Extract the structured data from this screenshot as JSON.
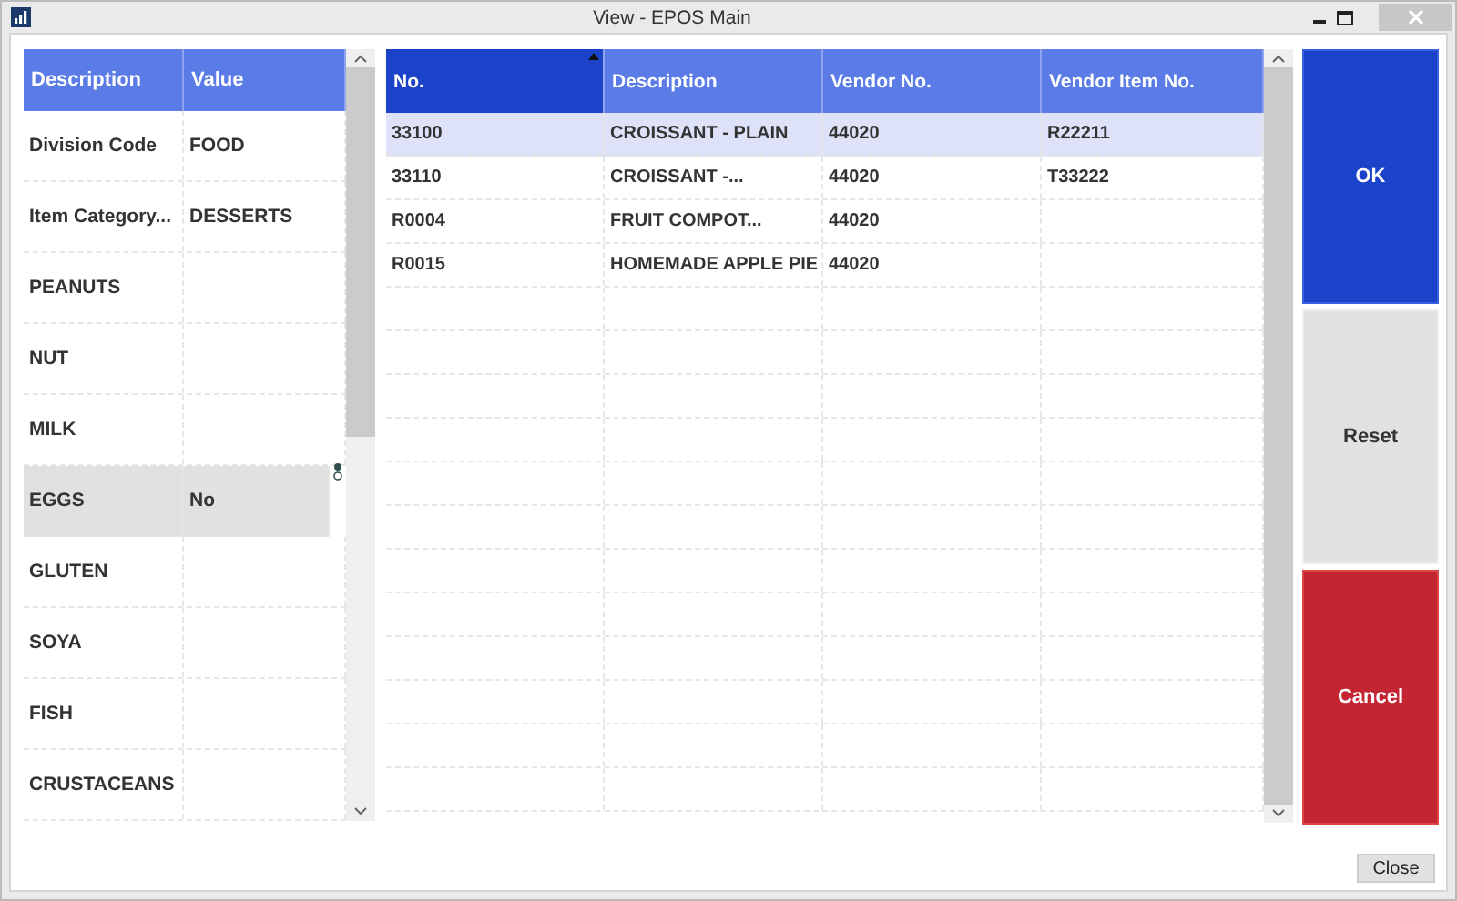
{
  "window": {
    "title": "View - EPOS Main"
  },
  "properties": {
    "columns": [
      "Description",
      "Value"
    ],
    "rows": [
      {
        "description": "Division Code",
        "value": "FOOD",
        "selected": false
      },
      {
        "description": "Item Category...",
        "value": "DESSERTS",
        "selected": false
      },
      {
        "description": "PEANUTS",
        "value": "",
        "selected": false
      },
      {
        "description": "NUT",
        "value": "",
        "selected": false
      },
      {
        "description": "MILK",
        "value": "",
        "selected": false
      },
      {
        "description": "EGGS",
        "value": "No",
        "selected": true
      },
      {
        "description": "GLUTEN",
        "value": "",
        "selected": false
      },
      {
        "description": "SOYA",
        "value": "",
        "selected": false
      },
      {
        "description": "FISH",
        "value": "",
        "selected": false
      },
      {
        "description": "CRUSTACEANS",
        "value": "",
        "selected": false
      }
    ]
  },
  "items": {
    "columns": [
      {
        "label": "No.",
        "sorted": true
      },
      {
        "label": "Description",
        "sorted": false
      },
      {
        "label": "Vendor No.",
        "sorted": false
      },
      {
        "label": "Vendor Item No.",
        "sorted": false
      }
    ],
    "rows": [
      {
        "cells": [
          "33100",
          "CROISSANT - PLAIN",
          "44020",
          "R22211"
        ],
        "selected": true
      },
      {
        "cells": [
          "33110",
          "CROISSANT -...",
          "44020",
          "T33222"
        ],
        "selected": false
      },
      {
        "cells": [
          "R0004",
          "FRUIT COMPOT...",
          "44020",
          ""
        ],
        "selected": false
      },
      {
        "cells": [
          "R0015",
          "HOMEMADE APPLE PIE",
          "44020",
          ""
        ],
        "selected": false
      }
    ]
  },
  "actions": [
    {
      "label": "OK",
      "kind": "primary"
    },
    {
      "label": "Reset",
      "kind": "neutral"
    },
    {
      "label": "Cancel",
      "kind": "danger"
    }
  ],
  "footer": {
    "close_button": "Close"
  }
}
